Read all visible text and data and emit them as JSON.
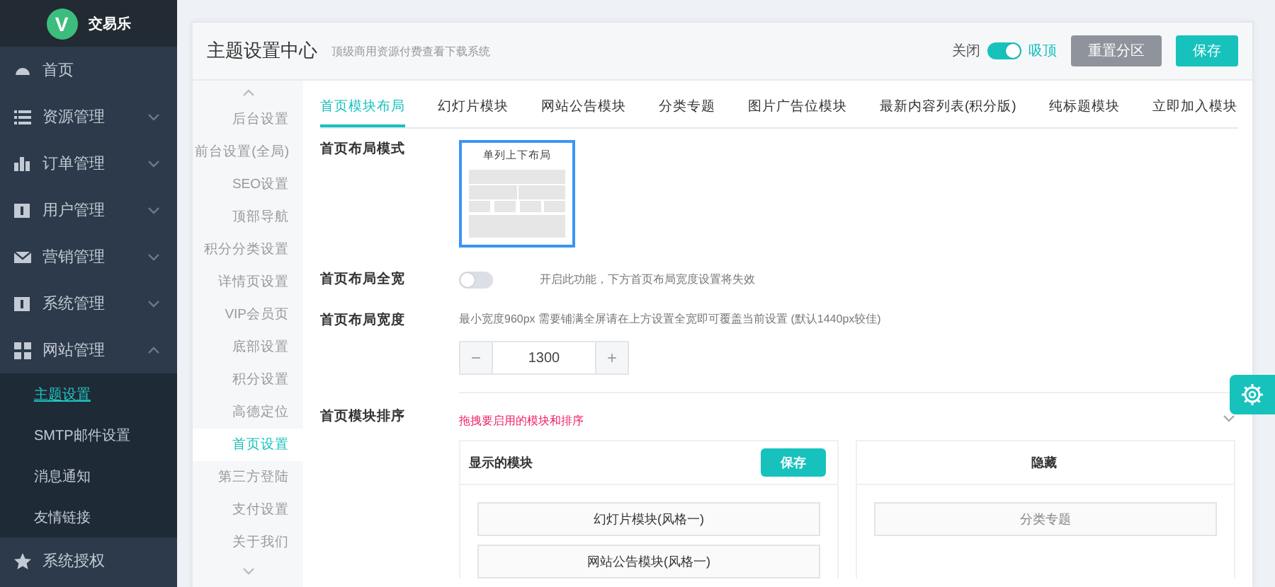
{
  "app": {
    "logo_letter": "V",
    "name": "交易乐"
  },
  "sidebar": {
    "items": [
      {
        "label": "首页",
        "kind": "link"
      },
      {
        "label": "资源管理",
        "kind": "group",
        "expanded": false
      },
      {
        "label": "订单管理",
        "kind": "group",
        "expanded": false
      },
      {
        "label": "用户管理",
        "kind": "group",
        "expanded": false
      },
      {
        "label": "营销管理",
        "kind": "group",
        "expanded": false
      },
      {
        "label": "系统管理",
        "kind": "group",
        "expanded": false
      },
      {
        "label": "网站管理",
        "kind": "group",
        "expanded": true,
        "children": [
          {
            "label": "主题设置",
            "selected": true
          },
          {
            "label": "SMTP邮件设置",
            "selected": false
          },
          {
            "label": "消息通知",
            "selected": false
          },
          {
            "label": "友情链接",
            "selected": false
          }
        ]
      },
      {
        "label": "系统授权",
        "kind": "link"
      }
    ]
  },
  "header": {
    "title": "主题设置中心",
    "subtitle": "顶级商用资源付费查看下载系统",
    "sticky": {
      "off_label": "关闭",
      "on_label": "吸顶",
      "on": true
    },
    "buttons": [
      {
        "label": "重置分区",
        "kind": "secondary"
      },
      {
        "label": "保存",
        "kind": "primary"
      }
    ]
  },
  "subnav": {
    "items": [
      {
        "label": "后台设置",
        "selected": false
      },
      {
        "label": "前台设置(全局)",
        "selected": false
      },
      {
        "label": "SEO设置",
        "selected": false
      },
      {
        "label": "顶部导航",
        "selected": false
      },
      {
        "label": "积分分类设置",
        "selected": false
      },
      {
        "label": "详情页设置",
        "selected": false
      },
      {
        "label": "VIP会员页",
        "selected": false
      },
      {
        "label": "底部设置",
        "selected": false
      },
      {
        "label": "积分设置",
        "selected": false
      },
      {
        "label": "高德定位",
        "selected": false
      },
      {
        "label": "首页设置",
        "selected": true
      },
      {
        "label": "第三方登陆",
        "selected": false
      },
      {
        "label": "支付设置",
        "selected": false
      },
      {
        "label": "关于我们",
        "selected": false
      }
    ]
  },
  "tabs": [
    {
      "label": "首页模块布局",
      "selected": true
    },
    {
      "label": "幻灯片模块",
      "selected": false
    },
    {
      "label": "网站公告模块",
      "selected": false
    },
    {
      "label": "分类专题",
      "selected": false
    },
    {
      "label": "图片广告位模块",
      "selected": false
    },
    {
      "label": "最新内容列表(积分版)",
      "selected": false
    },
    {
      "label": "纯标题模块",
      "selected": false
    },
    {
      "label": "立即加入模块",
      "selected": false
    }
  ],
  "form": {
    "layout_mode": {
      "label": "首页布局模式",
      "options": [
        {
          "label": "单列上下布局",
          "selected": true
        }
      ]
    },
    "full_width": {
      "label": "首页布局全宽",
      "on": false,
      "hint": "开启此功能，下方首页布局宽度设置将失效"
    },
    "width": {
      "label": "首页布局宽度",
      "hint": "最小宽度960px 需要铺满全屏请在上方设置全宽即可覆盖当前设置 (默认1440px较佳)",
      "minus": "−",
      "value": "1300",
      "plus": "+"
    },
    "order": {
      "label": "首页模块排序",
      "hint": "拖拽要启用的模块和排序",
      "shown": {
        "title": "显示的模块",
        "save_label": "保存",
        "items": [
          "幻灯片模块(风格一)",
          "网站公告模块(风格一)"
        ]
      },
      "hidden": {
        "title": "隐藏",
        "items": [
          "分类专题"
        ]
      }
    }
  }
}
